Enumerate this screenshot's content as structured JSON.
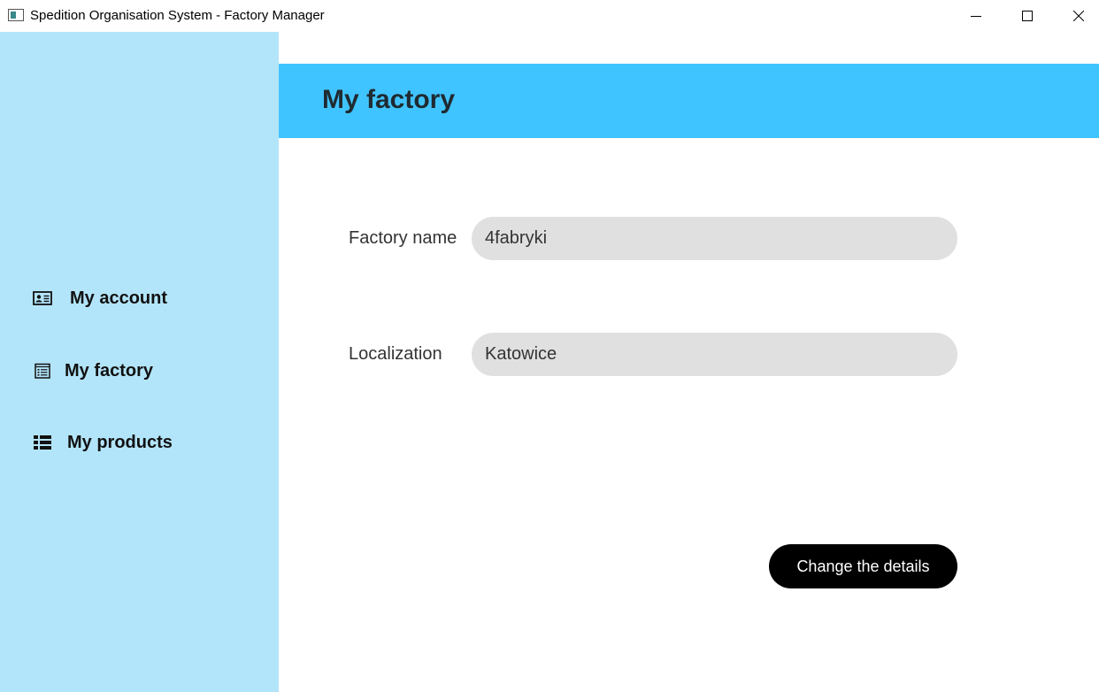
{
  "window": {
    "title": "Spedition Organisation System - Factory Manager",
    "app_icon": "app-window-icon",
    "controls": [
      "minimize-icon",
      "maximize-icon",
      "close-icon"
    ]
  },
  "sidebar": {
    "background": "#b3e5fa",
    "items": [
      {
        "label": "My account",
        "icon": "id-card-icon"
      },
      {
        "label": "My factory",
        "icon": "clipboard-list-icon"
      },
      {
        "label": "My products",
        "icon": "list-icon"
      }
    ]
  },
  "header": {
    "title": "My factory",
    "background": "#40c4ff"
  },
  "form": {
    "factory_name": {
      "label": "Factory name",
      "value": "4fabryki"
    },
    "localization": {
      "label": "Localization",
      "value": "Katowice"
    }
  },
  "actions": {
    "change_label": "Change the details"
  }
}
